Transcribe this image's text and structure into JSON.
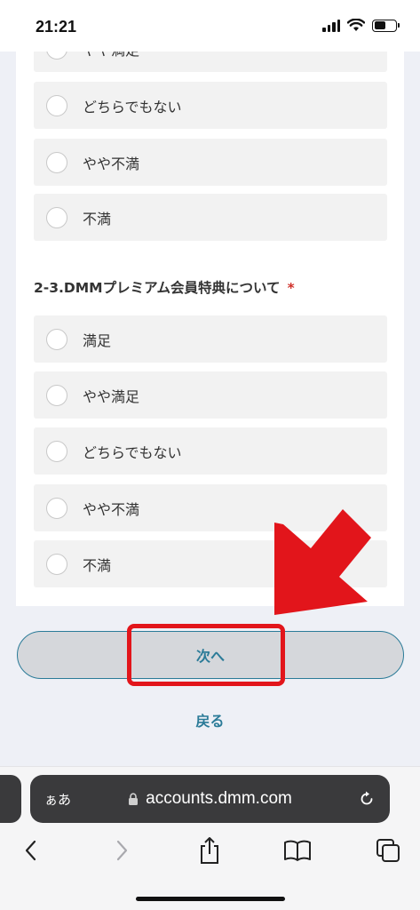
{
  "status_bar": {
    "time": "21:21",
    "icons": [
      "signal-icon",
      "wifi-icon",
      "battery-icon"
    ]
  },
  "form": {
    "group1_options": [
      {
        "label": "やや満足"
      },
      {
        "label": "どちらでもない"
      },
      {
        "label": "やや不満"
      },
      {
        "label": "不満"
      }
    ],
    "question2": {
      "title": "2-3.DMMプレミアム会員特典について",
      "required_mark": "*",
      "options": [
        {
          "label": "満足"
        },
        {
          "label": "やや満足"
        },
        {
          "label": "どちらでもない"
        },
        {
          "label": "やや不満"
        },
        {
          "label": "不満"
        }
      ]
    }
  },
  "actions": {
    "next_label": "次へ",
    "back_label": "戻る"
  },
  "browser": {
    "aa_label": "ぁあ",
    "url": "accounts.dmm.com",
    "toolbar_icons": [
      "back-icon",
      "forward-icon",
      "share-icon",
      "bookmarks-icon",
      "tabs-icon"
    ]
  },
  "colors": {
    "accent": "#2b7b98",
    "annotation_red": "#e2151b",
    "required": "#d0302a"
  }
}
